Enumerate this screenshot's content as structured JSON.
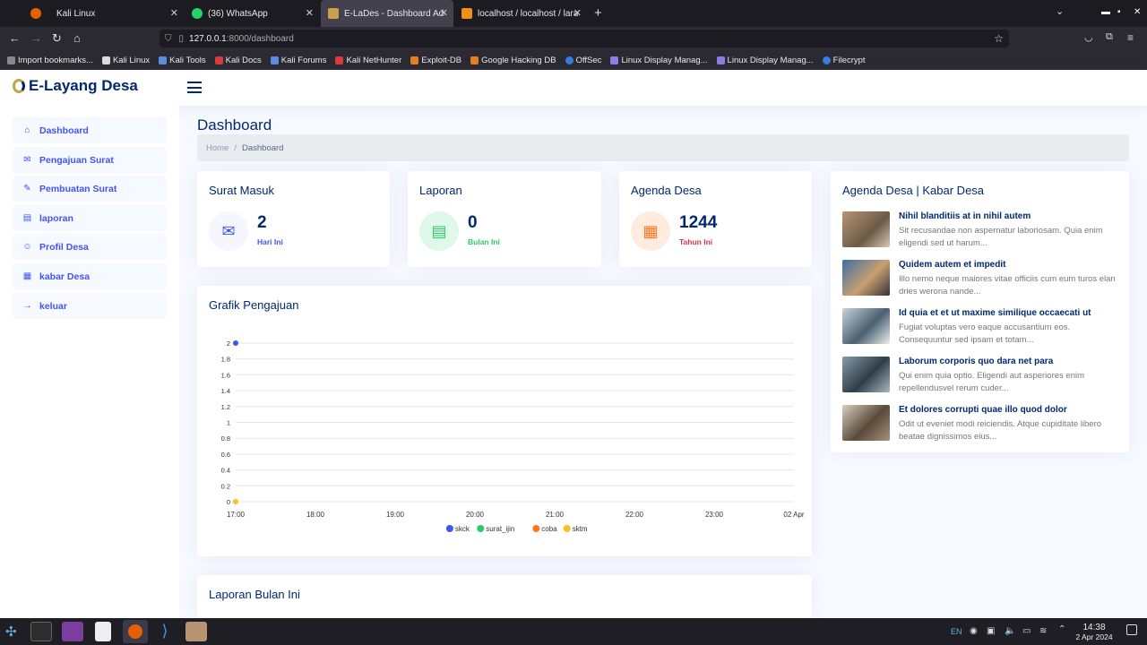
{
  "browser": {
    "tabs": [
      {
        "label": "Kali Linux",
        "active": false
      },
      {
        "label": "(36) WhatsApp",
        "active": false
      },
      {
        "label": "E-LaDes - Dashboard Admin",
        "active": true
      },
      {
        "label": "localhost / localhost / larav",
        "active": false
      }
    ],
    "new_tab": "+",
    "url_host": "127.0.0.1",
    "url_rest": ":8000/dashboard",
    "bookmarks": [
      "Import bookmarks...",
      "Kali Linux",
      "Kali Tools",
      "Kali Docs",
      "Kali Forums",
      "Kali NetHunter",
      "Exploit-DB",
      "Google Hacking DB",
      "OffSec",
      "Linux Display Manag...",
      "Linux Display Manag...",
      "Filecrypt"
    ]
  },
  "app": {
    "logo_text": "E-Layang Desa"
  },
  "sidebar": {
    "items": [
      {
        "label": "Dashboard",
        "icon": "home-icon"
      },
      {
        "label": "Pengajuan Surat",
        "icon": "envelope-icon"
      },
      {
        "label": "Pembuatan Surat",
        "icon": "pencil-icon"
      },
      {
        "label": "laporan",
        "icon": "document-icon"
      },
      {
        "label": "Profil Desa",
        "icon": "people-icon"
      },
      {
        "label": "kabar Desa",
        "icon": "newspaper-icon"
      },
      {
        "label": "keluar",
        "icon": "arrow-right-icon"
      }
    ]
  },
  "page": {
    "title": "Dashboard",
    "breadcrumb": {
      "home": "Home",
      "sep": "/",
      "current": "Dashboard"
    }
  },
  "cards": [
    {
      "title": "Surat Masuk",
      "value": "2",
      "sub": "Hari Ini",
      "accent": "#4154f1",
      "bg": "#f6f6fe",
      "icon": "envelope-icon"
    },
    {
      "title": "Laporan",
      "value": "0",
      "sub": "Bulan Ini",
      "accent": "#2eca6a",
      "bg": "#e0f8e9",
      "icon": "document-icon"
    },
    {
      "title": "Agenda Desa",
      "value": "1244",
      "sub": "Tahun Ini",
      "accent": "#ff771d",
      "bg": "#ffecdf",
      "icon": "calendar-icon"
    }
  ],
  "chart_card": {
    "title": "Grafik Pengajuan"
  },
  "chart_data": {
    "type": "line",
    "x": [
      "17:00",
      "18:00",
      "19:00",
      "20:00",
      "21:00",
      "22:00",
      "23:00",
      "02 Apr"
    ],
    "yticks": [
      "0",
      "0.2",
      "0.4",
      "0.6",
      "0.8",
      "1",
      "1.2",
      "1.4",
      "1.6",
      "1.8",
      "2"
    ],
    "ylim": [
      0,
      2
    ],
    "series": [
      {
        "name": "skck",
        "color": "#4154f1",
        "points": [
          {
            "x": "17:00",
            "y": 2
          }
        ]
      },
      {
        "name": "surat_ijin",
        "color": "#2eca6a",
        "points": []
      },
      {
        "name": "coba",
        "color": "#ff771d",
        "points": []
      },
      {
        "name": "sktm",
        "color": "#ffbb2c",
        "points": [
          {
            "x": "17:00",
            "y": 0
          }
        ]
      }
    ],
    "legend": "bottom",
    "grid": true
  },
  "report_card": {
    "title": "Laporan Bulan Ini"
  },
  "news": {
    "title": "Agenda Desa | Kabar Desa",
    "items": [
      {
        "title": "Nihil blanditiis at in nihil autem",
        "desc": "Sit recusandae non aspernatur laboriosam. Quia enim eligendi sed ut harum..."
      },
      {
        "title": "Quidem autem et impedit",
        "desc": "Illo nemo neque maiores vitae officiis cum eum turos elan dries werona nande..."
      },
      {
        "title": "Id quia et et ut maxime similique occaecati ut",
        "desc": "Fugiat voluptas vero eaque accusantium eos. Consequuntur sed ipsam et totam..."
      },
      {
        "title": "Laborum corporis quo dara net para",
        "desc": "Qui enim quia optio. Eligendi aut asperiores enim repellendusvel rerum cuder..."
      },
      {
        "title": "Et dolores corrupti quae illo quod dolor",
        "desc": "Odit ut eveniet modi reiciendis. Atque cupiditate libero beatae dignissimos eius..."
      }
    ]
  },
  "taskbar": {
    "lang": "EN",
    "time": "14:38",
    "date": "2 Apr 2024"
  }
}
